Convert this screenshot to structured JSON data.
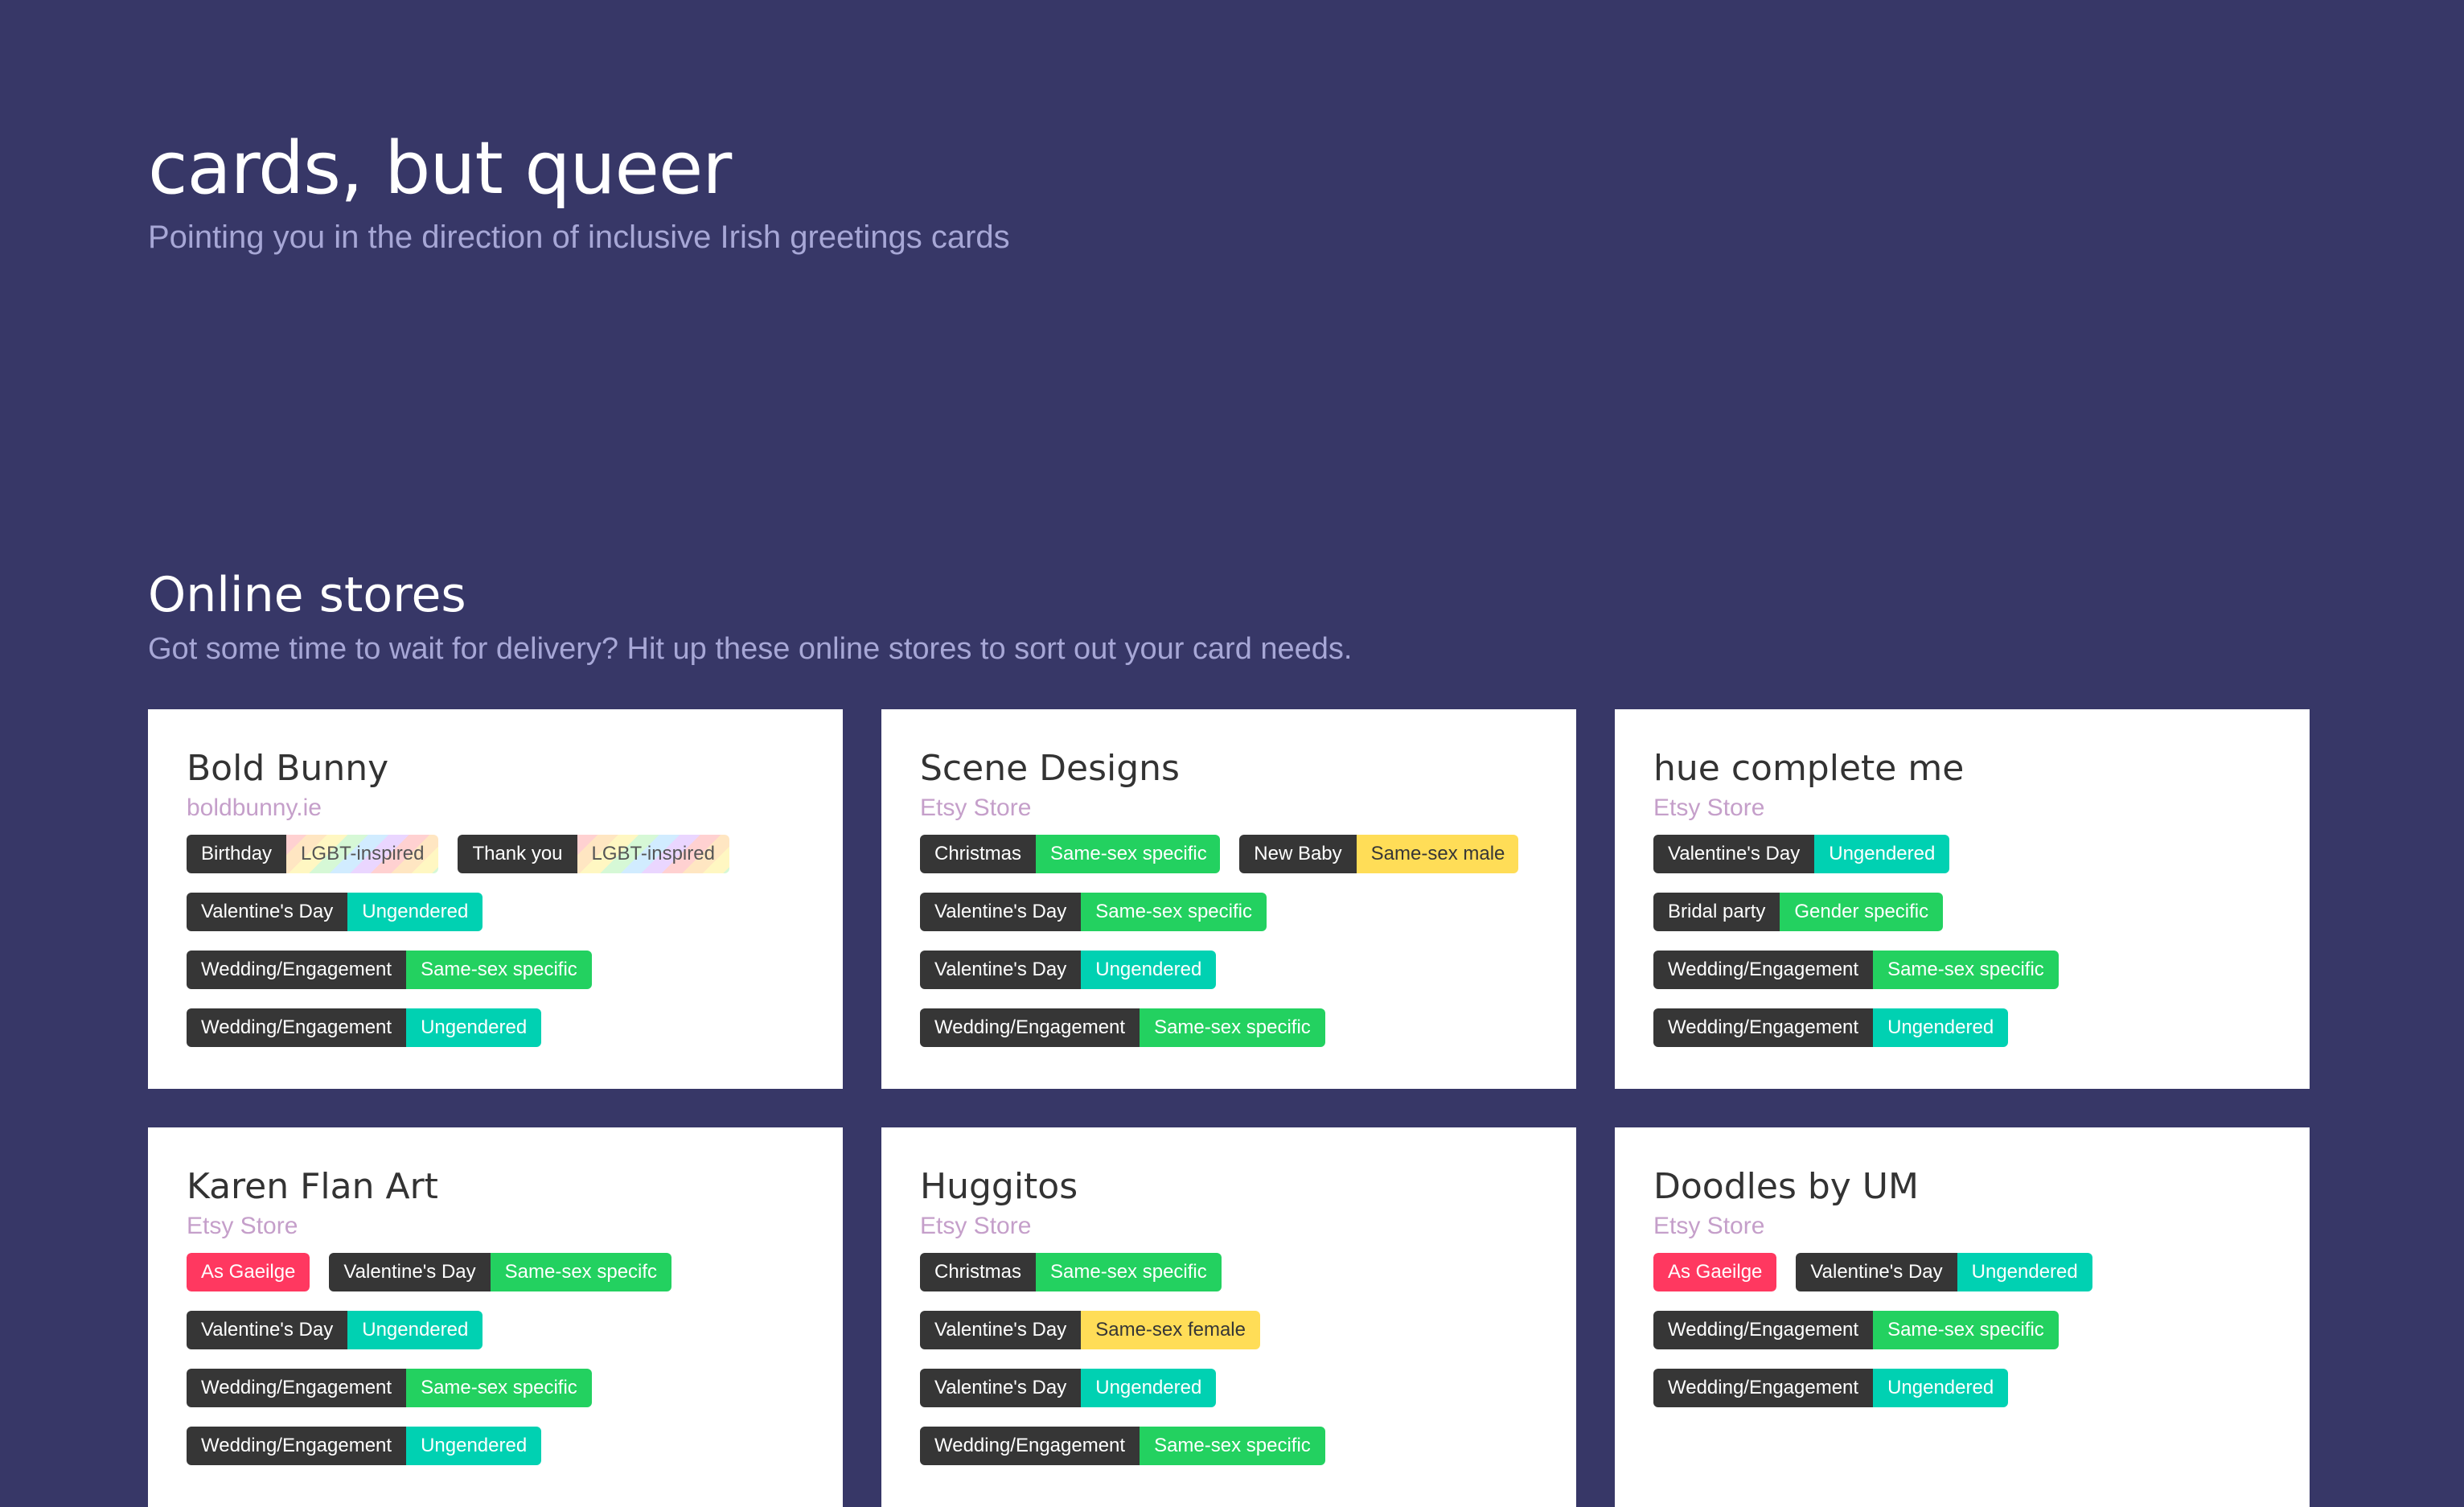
{
  "hero": {
    "title": "cards, but queer",
    "subtitle": "Pointing you in the direction of inclusive Irish greetings cards"
  },
  "online": {
    "title": "Online stores",
    "subtitle": "Got some time to wait for delivery? Hit up these online stores to sort out your card needs."
  },
  "colors": {
    "background": "#373767",
    "dark_tag": "#363636",
    "green_tag": "#23d160",
    "teal_tag": "#00d1b2",
    "yellow_tag": "#ffdd57",
    "pink_tag": "#ff3860",
    "link": "#c59fca"
  },
  "stores": [
    {
      "name": "Bold Bunny",
      "link": "boldbunny.ie",
      "rows": [
        [
          {
            "occasion": "Birthday",
            "label": "LGBT-inspired",
            "kind": "rainbow"
          },
          {
            "occasion": "Thank you",
            "label": "LGBT-inspired",
            "kind": "rainbow"
          }
        ],
        [
          {
            "occasion": "Valentine's Day",
            "label": "Ungendered",
            "kind": "teal"
          }
        ],
        [
          {
            "occasion": "Wedding/Engagement",
            "label": "Same-sex specific",
            "kind": "green"
          }
        ],
        [
          {
            "occasion": "Wedding/Engagement",
            "label": "Ungendered",
            "kind": "teal"
          }
        ]
      ]
    },
    {
      "name": "Scene Designs",
      "link": "Etsy Store",
      "rows": [
        [
          {
            "occasion": "Christmas",
            "label": "Same-sex specific",
            "kind": "green"
          },
          {
            "occasion": "New Baby",
            "label": "Same-sex male",
            "kind": "yellow"
          }
        ],
        [
          {
            "occasion": "Valentine's Day",
            "label": "Same-sex specific",
            "kind": "green"
          }
        ],
        [
          {
            "occasion": "Valentine's Day",
            "label": "Ungendered",
            "kind": "teal"
          }
        ],
        [
          {
            "occasion": "Wedding/Engagement",
            "label": "Same-sex specific",
            "kind": "green"
          }
        ]
      ]
    },
    {
      "name": "hue complete me",
      "link": "Etsy Store",
      "rows": [
        [
          {
            "occasion": "Valentine's Day",
            "label": "Ungendered",
            "kind": "teal"
          }
        ],
        [
          {
            "occasion": "Bridal party",
            "label": "Gender specific",
            "kind": "green"
          }
        ],
        [
          {
            "occasion": "Wedding/Engagement",
            "label": "Same-sex specific",
            "kind": "green"
          }
        ],
        [
          {
            "occasion": "Wedding/Engagement",
            "label": "Ungendered",
            "kind": "teal"
          }
        ]
      ]
    },
    {
      "name": "Karen Flan Art",
      "link": "Etsy Store",
      "rows": [
        [
          {
            "badge": "As Gaeilge"
          },
          {
            "occasion": "Valentine's Day",
            "label": "Same-sex specifc",
            "kind": "green"
          }
        ],
        [
          {
            "occasion": "Valentine's Day",
            "label": "Ungendered",
            "kind": "teal"
          }
        ],
        [
          {
            "occasion": "Wedding/Engagement",
            "label": "Same-sex specific",
            "kind": "green"
          }
        ],
        [
          {
            "occasion": "Wedding/Engagement",
            "label": "Ungendered",
            "kind": "teal"
          }
        ]
      ]
    },
    {
      "name": "Huggitos",
      "link": "Etsy Store",
      "rows": [
        [
          {
            "occasion": "Christmas",
            "label": "Same-sex specific",
            "kind": "green"
          }
        ],
        [
          {
            "occasion": "Valentine's Day",
            "label": "Same-sex female",
            "kind": "yellow"
          }
        ],
        [
          {
            "occasion": "Valentine's Day",
            "label": "Ungendered",
            "kind": "teal"
          }
        ],
        [
          {
            "occasion": "Wedding/Engagement",
            "label": "Same-sex specific",
            "kind": "green"
          }
        ]
      ]
    },
    {
      "name": "Doodles by UM",
      "link": "Etsy Store",
      "rows": [
        [
          {
            "badge": "As Gaeilge"
          },
          {
            "occasion": "Valentine's Day",
            "label": "Ungendered",
            "kind": "teal"
          }
        ],
        [
          {
            "occasion": "Wedding/Engagement",
            "label": "Same-sex specific",
            "kind": "green"
          }
        ],
        [
          {
            "occasion": "Wedding/Engagement",
            "label": "Ungendered",
            "kind": "teal"
          }
        ]
      ]
    }
  ]
}
